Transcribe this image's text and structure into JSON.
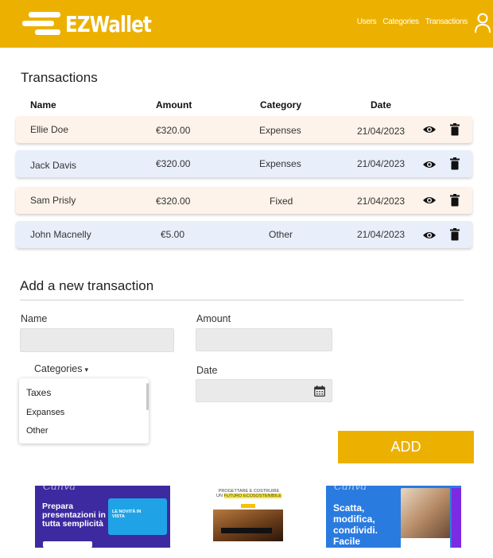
{
  "header": {
    "logo_text": "EZWallet",
    "nav": [
      "Users",
      "Categories",
      "Transactions"
    ],
    "brand_color": "#ecb100"
  },
  "transactions": {
    "title": "Transactions",
    "columns": [
      "Name",
      "Amount",
      "Category",
      "Date"
    ],
    "rows": [
      {
        "name": "Ellie Doe",
        "amount": "€320.00",
        "category": "Expenses",
        "date": "21/04/2023"
      },
      {
        "name": "Jack Davis",
        "amount": "€320.00",
        "category": "Expenses",
        "date": "21/04/2023"
      },
      {
        "name": "Sam Prisly",
        "amount": "€320.00",
        "category": "Fixed",
        "date": "21/04/2023"
      },
      {
        "name": "John Macnelly",
        "amount": "€5.00",
        "category": "Other",
        "date": "21/04/2023"
      }
    ]
  },
  "form": {
    "title": "Add a new transaction",
    "name_label": "Name",
    "amount_label": "Amount",
    "categories_label": "Categories",
    "date_label": "Date",
    "category_options": [
      "Taxes",
      "Expanses",
      "Other"
    ],
    "add_label": "ADD"
  },
  "ads": {
    "ad1": {
      "brand": "Canva",
      "headline": "Prepara presentazioni in tutta semplicità",
      "card_text": "LE NOVITÀ IN VISTA"
    },
    "ad2": {
      "line1": "PROGETTARE E COSTRUIRE",
      "line2_prefix": "UN ",
      "line2_highlight": "FUTURO ECOSOSTENIBILE"
    },
    "ad3": {
      "brand": "Canva",
      "headline": "Scatta, modifica, condividi. Facile"
    }
  }
}
